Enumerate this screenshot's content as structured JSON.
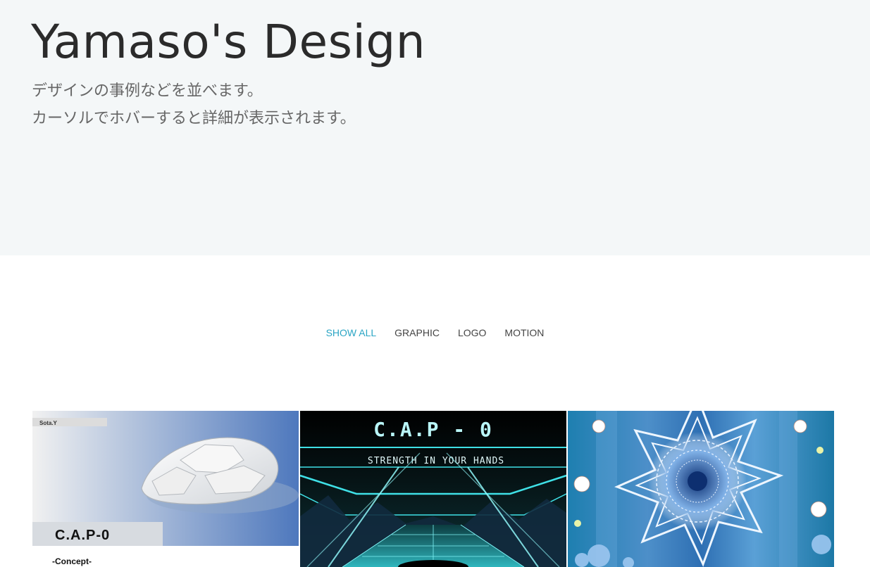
{
  "hero": {
    "title": "Yamaso's Design",
    "line1": "デザインの事例などを並べます。",
    "line2": "カーソルでホバーすると詳細が表示されます。"
  },
  "filters": [
    {
      "label": "SHOW ALL",
      "active": true
    },
    {
      "label": "GRAPHIC",
      "active": false
    },
    {
      "label": "LOGO",
      "active": false
    },
    {
      "label": "MOTION",
      "active": false
    }
  ],
  "portfolio": [
    {
      "author": "Sota.Y",
      "title": "C.A.P-0",
      "subtitle": "-Concept-"
    },
    {
      "title": "C.A.P - 0",
      "tagline": "STRENGTH IN YOUR HANDS"
    },
    {
      "label": ""
    }
  ],
  "colors": {
    "hero_bg": "#f4f7f8",
    "accent": "#2ba5c4",
    "text_dark": "#2b2b2b",
    "text_muted": "#666666"
  }
}
